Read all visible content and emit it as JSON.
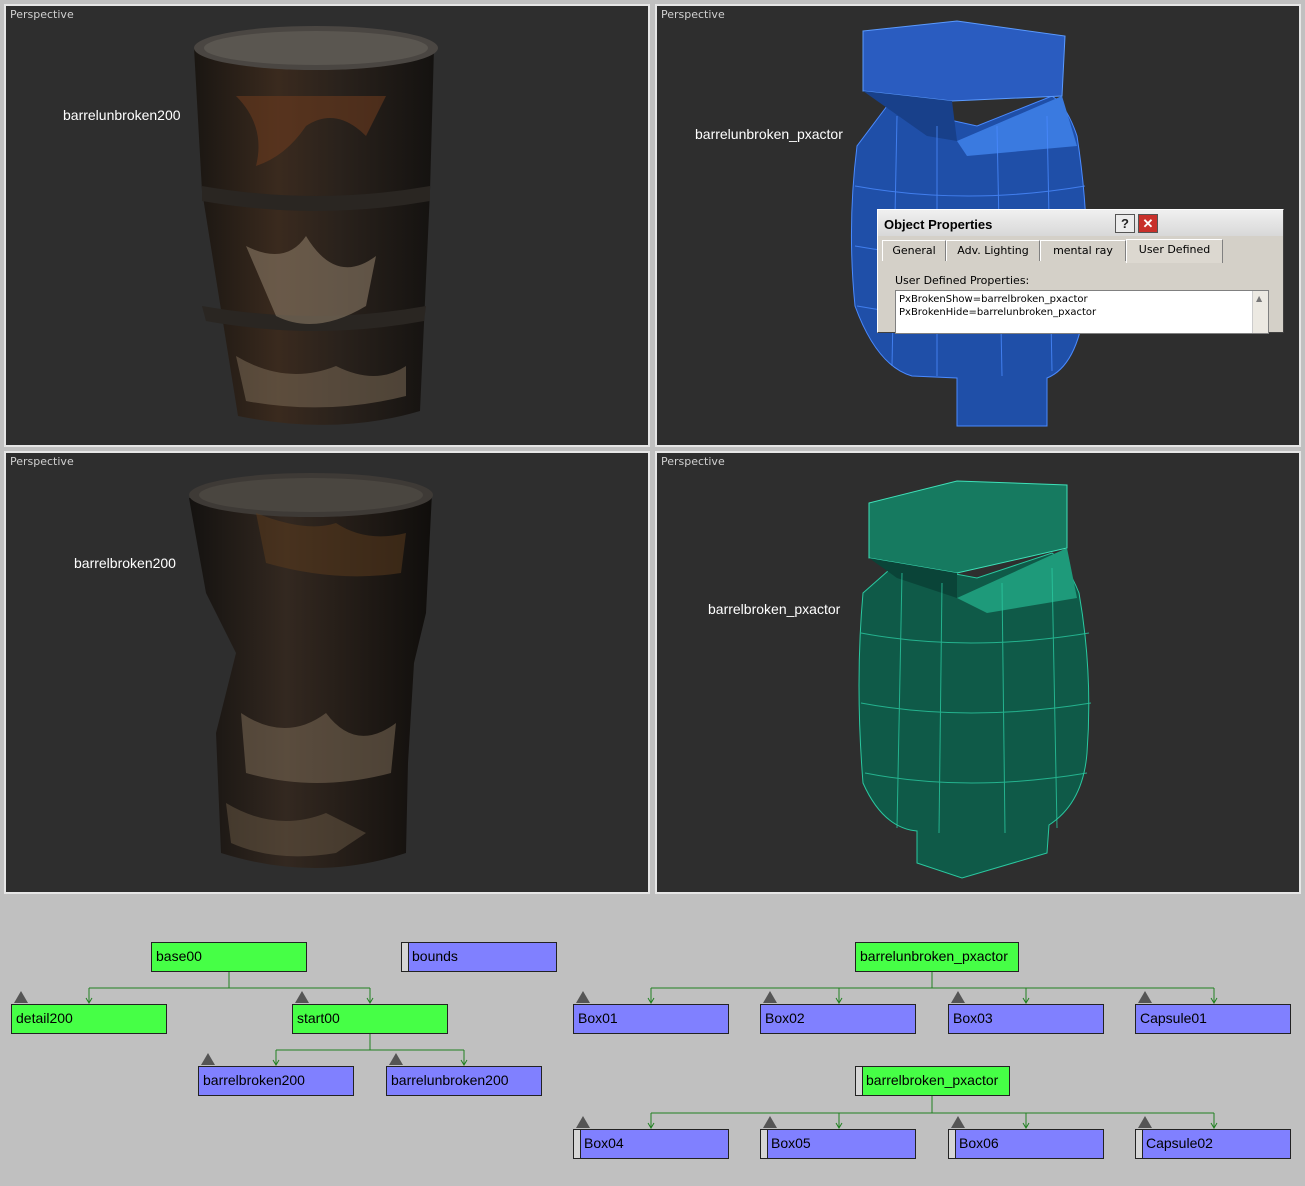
{
  "viewports": [
    {
      "title": "Perspective",
      "label": "barrelunbroken200"
    },
    {
      "title": "Perspective",
      "label": "barrelunbroken_pxactor"
    },
    {
      "title": "Perspective",
      "label": "barrelbroken200"
    },
    {
      "title": "Perspective",
      "label": "barrelbroken_pxactor"
    }
  ],
  "dialog": {
    "title": "Object Properties",
    "help_glyph": "?",
    "close_glyph": "✕",
    "tabs": [
      "General",
      "Adv. Lighting",
      "mental ray",
      "User Defined"
    ],
    "active_tab": "User Defined",
    "field_label": "User Defined Properties:",
    "lines": [
      "PxBrokenShow=barrelbroken_pxactor",
      "PxBrokenHide=barrelunbroken_pxactor"
    ],
    "scroll_glyph": "▲"
  },
  "schematic": {
    "base00": "base00",
    "bounds": "bounds",
    "detail200": "detail200",
    "start00": "start00",
    "barrelbroken200": "barrelbroken200",
    "barrelunbroken200": "barrelunbroken200",
    "barrelunbroken_pxactor": "barrelunbroken_pxactor",
    "box01": "Box01",
    "box02": "Box02",
    "box03": "Box03",
    "capsule01": "Capsule01",
    "barrelbroken_pxactor": "barrelbroken_pxactor",
    "box04": "Box04",
    "box05": "Box05",
    "box06": "Box06",
    "capsule02": "Capsule02"
  },
  "colors": {
    "node_green": "#46ff46",
    "node_blue": "#8080ff",
    "link_green": "#208020",
    "actor_blue": "#2a63c6",
    "actor_teal": "#1c8a6e"
  }
}
